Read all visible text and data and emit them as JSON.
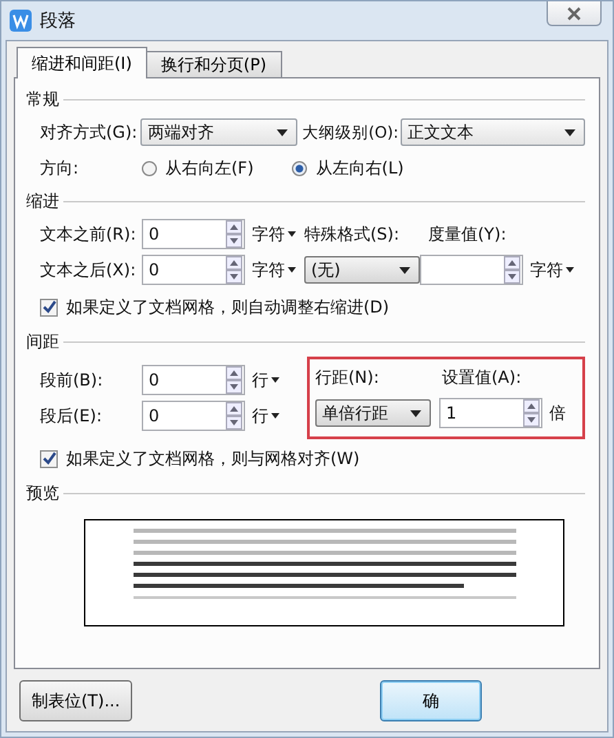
{
  "window": {
    "title": "段落"
  },
  "tabs": [
    {
      "label": "缩进和间距(I)",
      "selected": true
    },
    {
      "label": "换行和分页(P)",
      "selected": false
    }
  ],
  "general": {
    "title": "常规",
    "alignment": {
      "label": "对齐方式(G):",
      "value": "两端对齐"
    },
    "outline_level": {
      "label": "大纲级别(O):",
      "value": "正文文本"
    },
    "direction": {
      "label": "方向:",
      "options": [
        {
          "label": "从右向左(F)",
          "selected": false
        },
        {
          "label": "从左向右(L)",
          "selected": true
        }
      ]
    }
  },
  "indent": {
    "title": "缩进",
    "before": {
      "label": "文本之前(R):",
      "value": "0",
      "unit": "字符"
    },
    "after": {
      "label": "文本之后(X):",
      "value": "0",
      "unit": "字符"
    },
    "special": {
      "label": "特殊格式(S):",
      "value": "(无)"
    },
    "measure": {
      "label": "度量值(Y):",
      "unit": "字符"
    },
    "auto_adjust": {
      "label": "如果定义了文档网格，则自动调整右缩进(D)",
      "checked": true
    }
  },
  "spacing": {
    "title": "间距",
    "before": {
      "label": "段前(B):",
      "value": "0",
      "unit": "行"
    },
    "after": {
      "label": "段后(E):",
      "value": "0",
      "unit": "行"
    },
    "line_spacing": {
      "label": "行距(N):",
      "value": "单倍行距"
    },
    "amount": {
      "label": "设置值(A):",
      "value": "1",
      "unit": "倍"
    },
    "snap_to_grid": {
      "label": "如果定义了文档网格，则与网格对齐(W)",
      "checked": true
    }
  },
  "preview": {
    "title": "预览"
  },
  "buttons": [
    {
      "label": "制表位(T)...",
      "kind": "normal"
    },
    {
      "label": "确",
      "kind": "default"
    }
  ]
}
